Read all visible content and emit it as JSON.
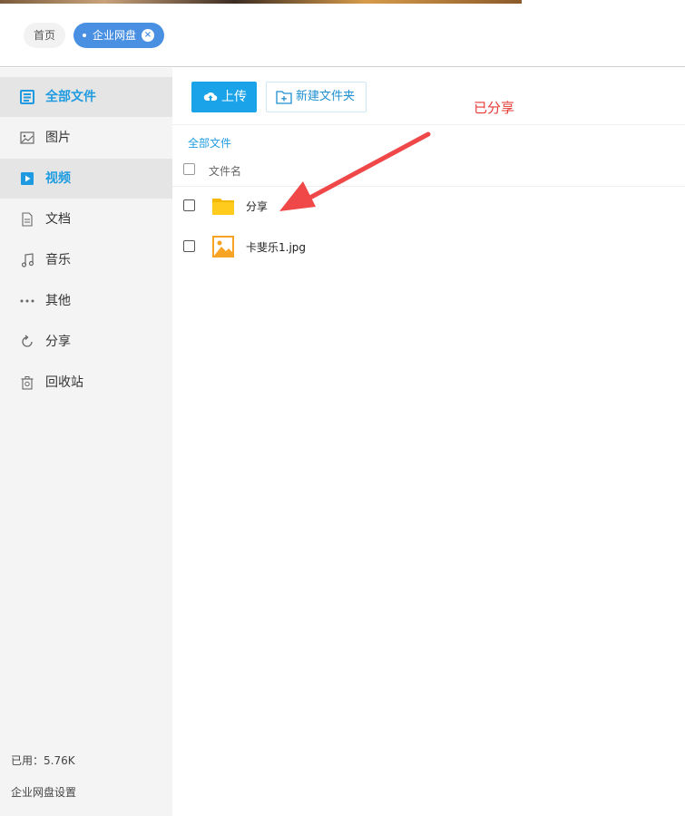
{
  "tabs": {
    "home": "首页",
    "active": "企业网盘"
  },
  "sidebar": {
    "items": [
      {
        "label": "全部文件",
        "icon": "all-files-icon"
      },
      {
        "label": "图片",
        "icon": "image-icon"
      },
      {
        "label": "视频",
        "icon": "video-icon"
      },
      {
        "label": "文档",
        "icon": "document-icon"
      },
      {
        "label": "音乐",
        "icon": "music-icon"
      },
      {
        "label": "其他",
        "icon": "more-icon"
      },
      {
        "label": "分享",
        "icon": "share-icon"
      },
      {
        "label": "回收站",
        "icon": "recycle-bin-icon"
      }
    ],
    "usage": "已用：5.76K",
    "settings": "企业网盘设置"
  },
  "toolbar": {
    "upload": "上传",
    "new_folder": "新建文件夹"
  },
  "breadcrumb": "全部文件",
  "table": {
    "header": "文件名",
    "rows": [
      {
        "name": "分享",
        "type": "folder"
      },
      {
        "name": "卡斐乐1.jpg",
        "type": "image"
      }
    ]
  },
  "annotation": "已分享",
  "colors": {
    "accent": "#1aa3e8",
    "tab_active": "#4a90e2",
    "folder": "#f5b800",
    "annotation": "#e53935"
  }
}
